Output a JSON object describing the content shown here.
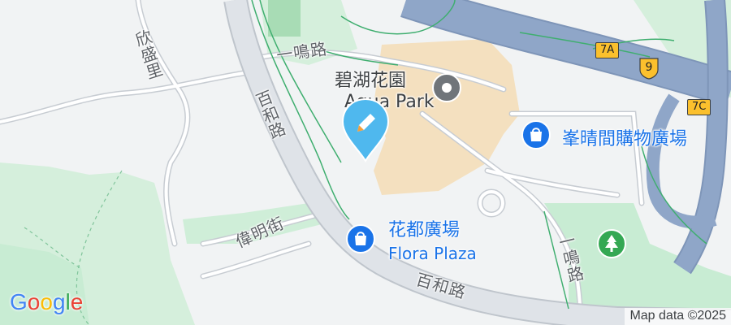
{
  "map": {
    "colors": {
      "background": "#f1f3f4",
      "park": "#c8ecd3",
      "road": "#dfe3e8",
      "road_outline": "#c7ccd2",
      "expressway": "#8fa6c8",
      "footpath": "#3fae6f",
      "building": "#f4e0bf",
      "poi_blue": "#1a73e8",
      "poi_gray": "#70757a",
      "poi_green": "#34a853",
      "location_pin": "#4fb8ee"
    },
    "streets": {
      "yat_ming_road_top": "一鳴路",
      "yan_shing_lane": "欣盛里",
      "pak_wo_road_upper": "百和路",
      "wai_ming_street": "偉明街",
      "pak_wo_road_lower": "百和路",
      "yat_ming_road_right": "一鳴路"
    },
    "route_shields": {
      "exit_7a": "7A",
      "route_9": "9",
      "exit_7c": "7C"
    },
    "pois": {
      "aqua_park": {
        "name_zh": "碧湖花園",
        "name_en": "Aqua Park",
        "icon": "city-icon"
      },
      "shopping": {
        "name_zh": "峯晴間購物廣場",
        "icon": "shopping-bag-icon"
      },
      "flora_plaza": {
        "name_zh": "花都廣場",
        "name_en": "Flora Plaza",
        "icon": "shopping-bag-icon"
      },
      "park": {
        "icon": "tree-icon"
      }
    },
    "location_marker": {
      "icon": "pencil-marker-icon"
    },
    "logo": {
      "text": "Google"
    },
    "attribution": "Map data ©2025"
  }
}
